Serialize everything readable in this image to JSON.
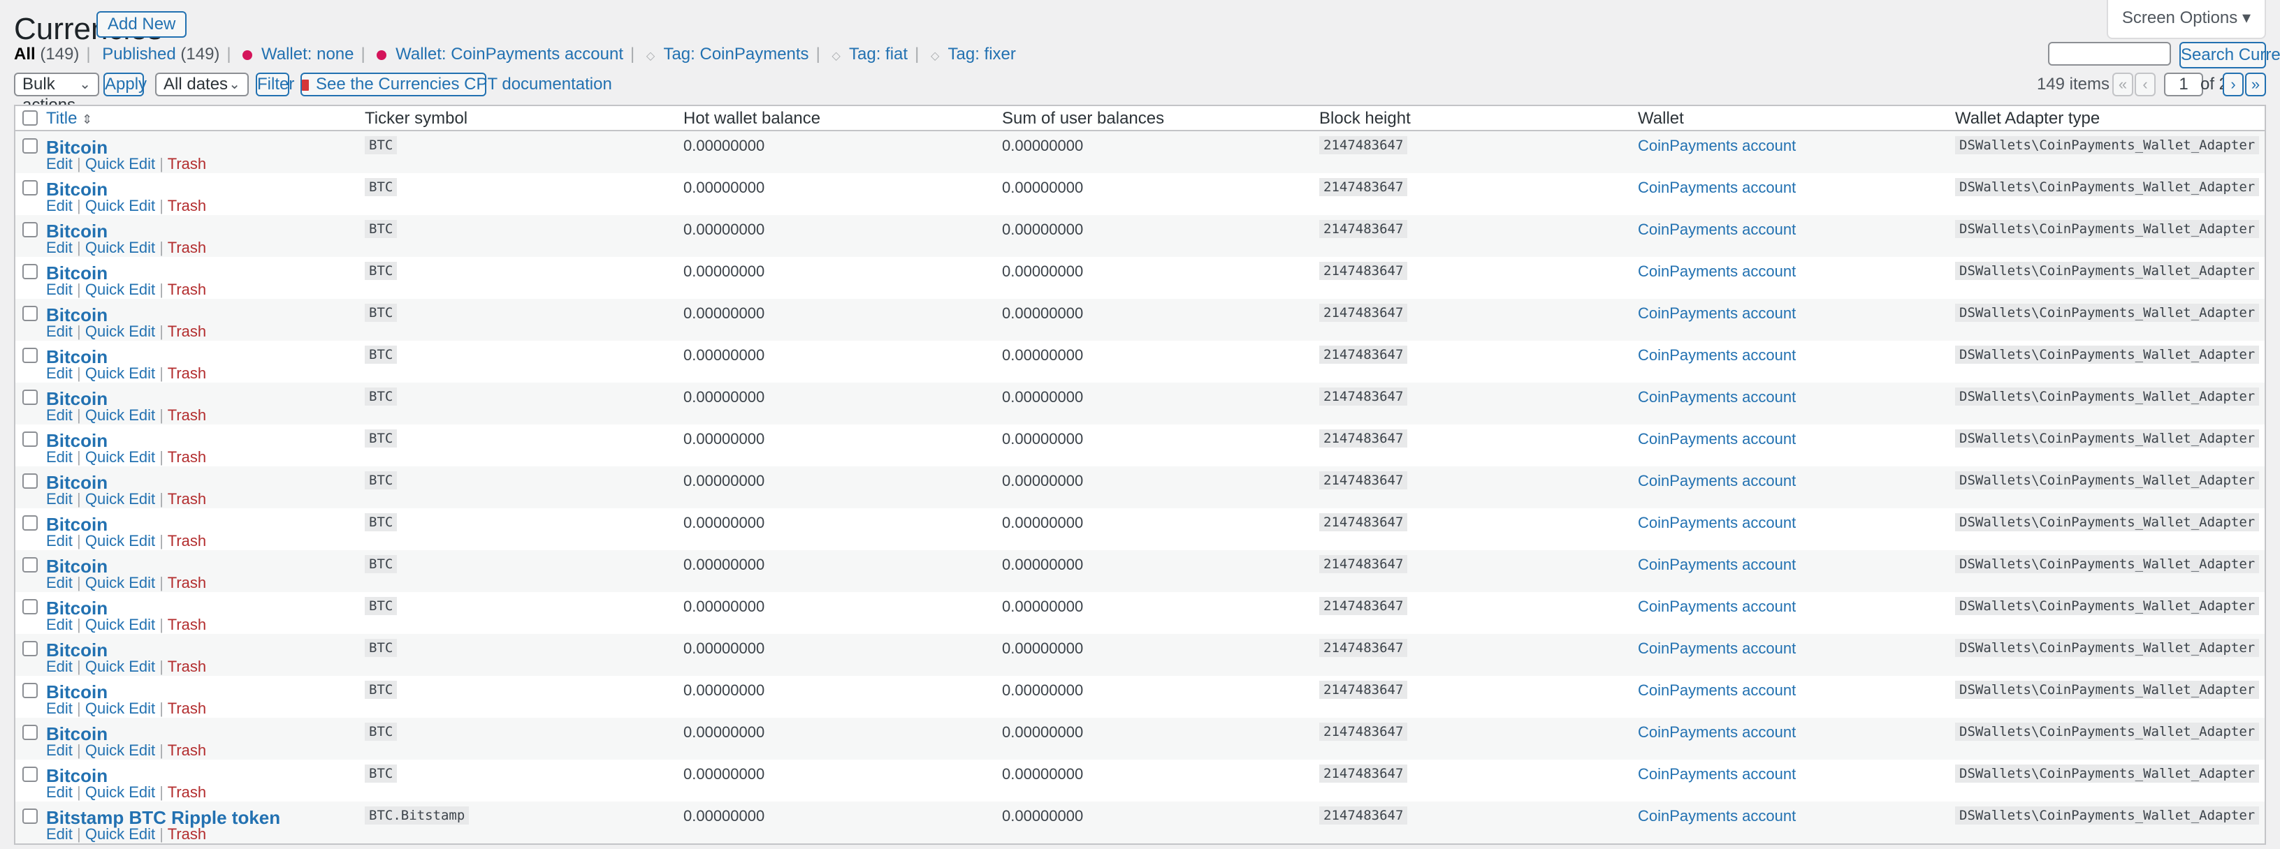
{
  "page": {
    "title": "Currencies",
    "add_new": "Add New",
    "screen_options": "Screen Options",
    "screen_options_caret": "▾"
  },
  "views": {
    "all": "All",
    "all_count": "(149)",
    "published": "Published",
    "published_count": "(149)",
    "wallet_none": "Wallet: none",
    "wallet_coinpayments": "Wallet: CoinPayments account",
    "tag_coinpayments": "Tag: CoinPayments",
    "tag_fiat": "Tag: fiat",
    "tag_fixer": "Tag: fixer",
    "sep": "|",
    "wallet_dot_color": "#d4145a"
  },
  "search": {
    "value": "",
    "button": "Search Currencies"
  },
  "tablenav": {
    "bulk_actions": "Bulk actions",
    "apply": "Apply",
    "dates": "All dates",
    "filter": "Filter",
    "docs": "See the Currencies CPT documentation",
    "items_count": "149 items",
    "first": "«",
    "prev": "‹",
    "current_page": "1",
    "of_pages": "of 2",
    "next": "›",
    "last": "»"
  },
  "columns": {
    "title": "Title",
    "sort_indicator": "⇕",
    "ticker": "Ticker symbol",
    "hot": "Hot wallet balance",
    "sum": "Sum of user balances",
    "block": "Block height",
    "wallet": "Wallet",
    "adapter": "Wallet Adapter type"
  },
  "row_actions": {
    "edit": "Edit",
    "quick_edit": "Quick Edit",
    "trash": "Trash",
    "sep": "|"
  },
  "rows": [
    {
      "title": "Bitcoin",
      "ticker": "BTC",
      "hot": "0.00000000",
      "sum": "0.00000000",
      "block": "2147483647",
      "wallet": "CoinPayments account",
      "adapter": "DSWallets\\CoinPayments_Wallet_Adapter"
    },
    {
      "title": "Bitcoin",
      "ticker": "BTC",
      "hot": "0.00000000",
      "sum": "0.00000000",
      "block": "2147483647",
      "wallet": "CoinPayments account",
      "adapter": "DSWallets\\CoinPayments_Wallet_Adapter"
    },
    {
      "title": "Bitcoin",
      "ticker": "BTC",
      "hot": "0.00000000",
      "sum": "0.00000000",
      "block": "2147483647",
      "wallet": "CoinPayments account",
      "adapter": "DSWallets\\CoinPayments_Wallet_Adapter"
    },
    {
      "title": "Bitcoin",
      "ticker": "BTC",
      "hot": "0.00000000",
      "sum": "0.00000000",
      "block": "2147483647",
      "wallet": "CoinPayments account",
      "adapter": "DSWallets\\CoinPayments_Wallet_Adapter"
    },
    {
      "title": "Bitcoin",
      "ticker": "BTC",
      "hot": "0.00000000",
      "sum": "0.00000000",
      "block": "2147483647",
      "wallet": "CoinPayments account",
      "adapter": "DSWallets\\CoinPayments_Wallet_Adapter"
    },
    {
      "title": "Bitcoin",
      "ticker": "BTC",
      "hot": "0.00000000",
      "sum": "0.00000000",
      "block": "2147483647",
      "wallet": "CoinPayments account",
      "adapter": "DSWallets\\CoinPayments_Wallet_Adapter"
    },
    {
      "title": "Bitcoin",
      "ticker": "BTC",
      "hot": "0.00000000",
      "sum": "0.00000000",
      "block": "2147483647",
      "wallet": "CoinPayments account",
      "adapter": "DSWallets\\CoinPayments_Wallet_Adapter"
    },
    {
      "title": "Bitcoin",
      "ticker": "BTC",
      "hot": "0.00000000",
      "sum": "0.00000000",
      "block": "2147483647",
      "wallet": "CoinPayments account",
      "adapter": "DSWallets\\CoinPayments_Wallet_Adapter"
    },
    {
      "title": "Bitcoin",
      "ticker": "BTC",
      "hot": "0.00000000",
      "sum": "0.00000000",
      "block": "2147483647",
      "wallet": "CoinPayments account",
      "adapter": "DSWallets\\CoinPayments_Wallet_Adapter"
    },
    {
      "title": "Bitcoin",
      "ticker": "BTC",
      "hot": "0.00000000",
      "sum": "0.00000000",
      "block": "2147483647",
      "wallet": "CoinPayments account",
      "adapter": "DSWallets\\CoinPayments_Wallet_Adapter"
    },
    {
      "title": "Bitcoin",
      "ticker": "BTC",
      "hot": "0.00000000",
      "sum": "0.00000000",
      "block": "2147483647",
      "wallet": "CoinPayments account",
      "adapter": "DSWallets\\CoinPayments_Wallet_Adapter"
    },
    {
      "title": "Bitcoin",
      "ticker": "BTC",
      "hot": "0.00000000",
      "sum": "0.00000000",
      "block": "2147483647",
      "wallet": "CoinPayments account",
      "adapter": "DSWallets\\CoinPayments_Wallet_Adapter"
    },
    {
      "title": "Bitcoin",
      "ticker": "BTC",
      "hot": "0.00000000",
      "sum": "0.00000000",
      "block": "2147483647",
      "wallet": "CoinPayments account",
      "adapter": "DSWallets\\CoinPayments_Wallet_Adapter"
    },
    {
      "title": "Bitcoin",
      "ticker": "BTC",
      "hot": "0.00000000",
      "sum": "0.00000000",
      "block": "2147483647",
      "wallet": "CoinPayments account",
      "adapter": "DSWallets\\CoinPayments_Wallet_Adapter"
    },
    {
      "title": "Bitcoin",
      "ticker": "BTC",
      "hot": "0.00000000",
      "sum": "0.00000000",
      "block": "2147483647",
      "wallet": "CoinPayments account",
      "adapter": "DSWallets\\CoinPayments_Wallet_Adapter"
    },
    {
      "title": "Bitcoin",
      "ticker": "BTC",
      "hot": "0.00000000",
      "sum": "0.00000000",
      "block": "2147483647",
      "wallet": "CoinPayments account",
      "adapter": "DSWallets\\CoinPayments_Wallet_Adapter"
    },
    {
      "title": "Bitstamp BTC Ripple token",
      "ticker": "BTC.Bitstamp",
      "hot": "0.00000000",
      "sum": "0.00000000",
      "block": "2147483647",
      "wallet": "CoinPayments account",
      "adapter": "DSWallets\\CoinPayments_Wallet_Adapter"
    }
  ]
}
